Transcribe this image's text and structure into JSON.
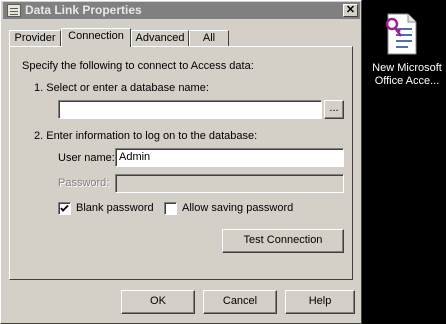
{
  "window": {
    "title": "Data Link Properties",
    "close_glyph": "✕"
  },
  "tabs": [
    {
      "label": "Provider",
      "active": false
    },
    {
      "label": "Connection",
      "active": true
    },
    {
      "label": "Advanced",
      "active": false
    },
    {
      "label": "All",
      "active": false
    }
  ],
  "connection": {
    "intro": "Specify the following to connect to Access data:",
    "step1_label": "1. Select or enter a database name:",
    "database_value": "",
    "browse_label": "...",
    "step2_label": "2. Enter information to log on to the database:",
    "username_label": "User name:",
    "username_value": "Admin",
    "password_label": "Password:",
    "password_value": "",
    "blank_password_label": "Blank password",
    "blank_password_checked": true,
    "allow_saving_label": "Allow saving password",
    "allow_saving_checked": false,
    "test_connection_label": "Test Connection"
  },
  "footer": {
    "ok_label": "OK",
    "cancel_label": "Cancel",
    "help_label": "Help"
  },
  "desktop": {
    "icon_line1": "New Microsoft",
    "icon_line2": "Office Acce...",
    "icon_name": "access-database-file-icon"
  },
  "colors": {
    "dialog_face": "#d4d0c8",
    "titlebar_inactive": "#808080",
    "desktop_background": "#000000",
    "access_key_purple": "#a0208c"
  }
}
